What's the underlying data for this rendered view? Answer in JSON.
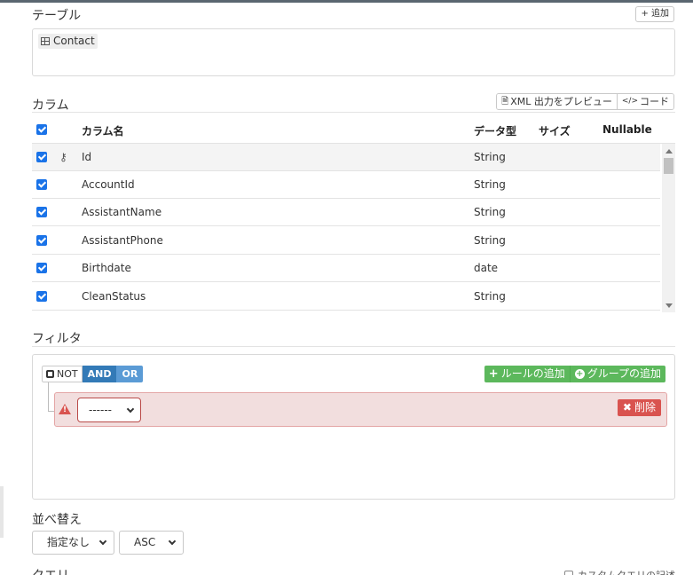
{
  "table_section": {
    "title": "テーブル",
    "add_button": "+ 追加",
    "tables": [
      {
        "name": "Contact",
        "icon": "table-grid-icon"
      }
    ]
  },
  "columns_section": {
    "title": "カラム",
    "preview_button": "XML 出力をプレビュー",
    "code_button": "コード",
    "headers": {
      "name": "カラム名",
      "type": "データ型",
      "size": "サイズ",
      "nullable": "Nullable"
    },
    "rows": [
      {
        "name": "Id",
        "type": "String",
        "checked": true,
        "key": true
      },
      {
        "name": "AccountId",
        "type": "String",
        "checked": true,
        "key": false
      },
      {
        "name": "AssistantName",
        "type": "String",
        "checked": true,
        "key": false
      },
      {
        "name": "AssistantPhone",
        "type": "String",
        "checked": true,
        "key": false
      },
      {
        "name": "Birthdate",
        "type": "date",
        "checked": true,
        "key": false
      },
      {
        "name": "CleanStatus",
        "type": "String",
        "checked": true,
        "key": false
      }
    ]
  },
  "filter_section": {
    "title": "フィルタ",
    "not_label": "NOT",
    "and_label": "AND",
    "or_label": "OR",
    "add_rule": "ルールの追加",
    "add_group": "グループの追加",
    "rule_select_value": "------",
    "delete_button": "削除"
  },
  "sort_section": {
    "title": "並べ替え",
    "sort_field": "指定なし",
    "sort_order": "ASC"
  },
  "query_section": {
    "title": "クエリ",
    "custom_query_label": "カスタムクエリの記述"
  },
  "colors": {
    "accent": "#1a73e8",
    "and": "#337ab7",
    "or": "#5b9bd5",
    "success": "#5cb85c",
    "danger": "#d9534f",
    "error_bg": "#f2dede"
  }
}
